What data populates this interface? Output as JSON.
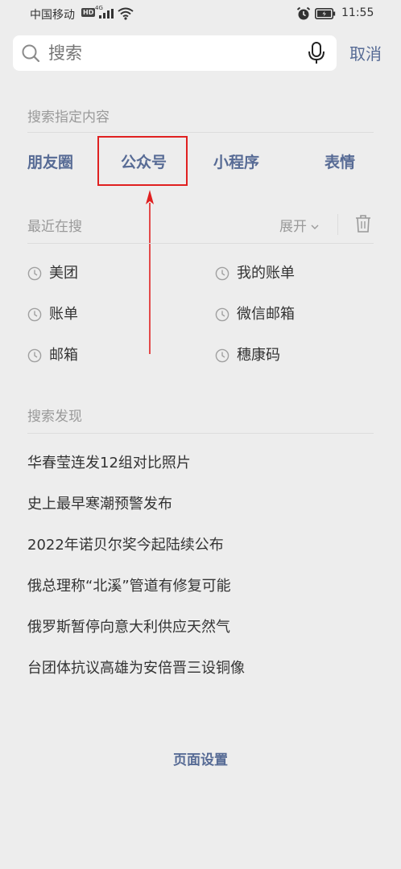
{
  "status_bar": {
    "carrier": "中国移动",
    "hd_badge": "HD",
    "network": "4G",
    "time": "11:55"
  },
  "search": {
    "placeholder": "搜索",
    "cancel_label": "取消"
  },
  "search_specific": {
    "title": "搜索指定内容",
    "categories": [
      "朋友圈",
      "公众号",
      "小程序",
      "表情"
    ]
  },
  "recent": {
    "title": "最近在搜",
    "expand_label": "展开",
    "items": [
      "美团",
      "我的账单",
      "账单",
      "微信邮箱",
      "邮箱",
      "穗康码"
    ]
  },
  "discover": {
    "title": "搜索发现",
    "items": [
      "华春莹连发12组对比照片",
      "史上最早寒潮预警发布",
      "2022年诺贝尔奖今起陆续公布",
      "俄总理称“北溪”管道有修复可能",
      "俄罗斯暂停向意大利供应天然气",
      "台团体抗议高雄为安倍晋三设铜像"
    ]
  },
  "footer": {
    "page_settings_label": "页面设置"
  },
  "colors": {
    "background": "#ededed",
    "link": "#576b95",
    "annotation": "#e02020"
  }
}
